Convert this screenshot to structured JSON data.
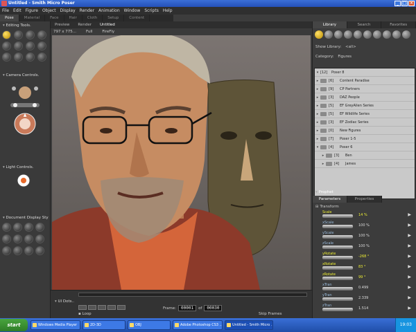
{
  "window": {
    "title": "Untitled - Smith Micro Poser"
  },
  "menu": [
    "File",
    "Edit",
    "Figure",
    "Object",
    "Display",
    "Render",
    "Animation",
    "Window",
    "Scripts",
    "Help"
  ],
  "rooms": [
    "Pose",
    "Material",
    "Face",
    "Hair",
    "Cloth",
    "Setup",
    "Content"
  ],
  "left": {
    "editing": "Editing Tools.",
    "camera": "Camera Controls.",
    "light": "Light Controls.",
    "display": "Document Display Sty"
  },
  "viewport": {
    "tabs": [
      "Preview",
      "Render",
      "Untitled"
    ],
    "size": "797 x 775...",
    "quality": "Full",
    "renderer": "FireFly"
  },
  "timeline": {
    "label": "UI Dots..",
    "frame_label": "Frame:",
    "frame": "00001",
    "of": "of",
    "total": "00030",
    "loop": "Loop",
    "skip": "Skip Frames"
  },
  "library": {
    "tabs": [
      "Library",
      "Search",
      "Favorites"
    ],
    "show_label": "Show Library:",
    "show_value": "<all>",
    "category_label": "Category:",
    "category_value": "Figures",
    "root": {
      "count": "[12]",
      "name": "Poser 8"
    },
    "items": [
      {
        "count": "[6]",
        "name": "Content Paradise"
      },
      {
        "count": "[9]",
        "name": "CP Partners"
      },
      {
        "count": "[3]",
        "name": "DAZ People"
      },
      {
        "count": "[5]",
        "name": "EF GreyAlien Series"
      },
      {
        "count": "[5]",
        "name": "EF Wildlife Series"
      },
      {
        "count": "[3]",
        "name": "EF Zodiac Series"
      },
      {
        "count": "[0]",
        "name": "New Figures"
      },
      {
        "count": "[7]",
        "name": "Poser 1-5"
      },
      {
        "count": "[4]",
        "name": "Poser 6"
      },
      {
        "count": "[3]",
        "name": "Ben"
      },
      {
        "count": "[4]",
        "name": "James"
      }
    ]
  },
  "prophet": {
    "title": "Prophet",
    "tabs": [
      "Parameters",
      "Properties"
    ],
    "group": "Transform",
    "params": [
      {
        "name": "Scale",
        "value": "14 %"
      },
      {
        "name": "xScale",
        "value": "100 %"
      },
      {
        "name": "yScale",
        "value": "100 %"
      },
      {
        "name": "zScale",
        "value": "100 %"
      },
      {
        "name": "yRotate",
        "value": "-268 °"
      },
      {
        "name": "xRotate",
        "value": "83 °"
      },
      {
        "name": "zRotate",
        "value": "99 °"
      },
      {
        "name": "xTran",
        "value": "0.499"
      },
      {
        "name": "yTran",
        "value": "2.339"
      },
      {
        "name": "zTran",
        "value": "1.514"
      }
    ]
  },
  "taskbar": {
    "start": "start",
    "tasks": [
      "Windows Media Player",
      "2D-3D",
      "OBJ",
      "Adobe Photoshop CS3 ...",
      "Untitled - Smith Micro ..."
    ],
    "clock": "19:03"
  }
}
